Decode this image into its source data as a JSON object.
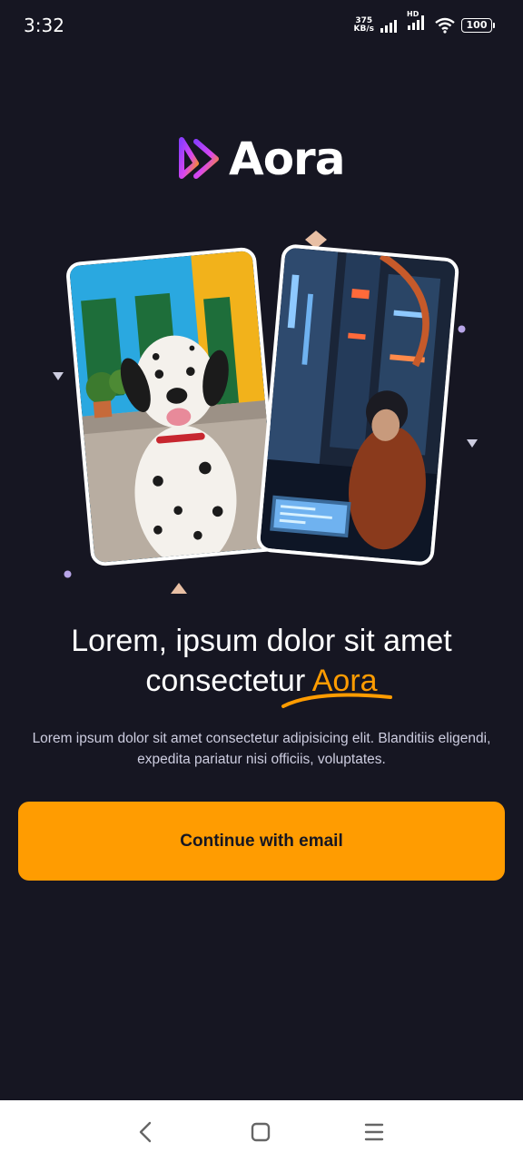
{
  "status_bar": {
    "time": "3:32",
    "net_speed_value": "375",
    "net_speed_unit": "KB/s",
    "network_badge": "HD",
    "battery": "100"
  },
  "brand": {
    "name": "Aora",
    "accent_color": "#FF9C01",
    "background_color": "#161622"
  },
  "hero": {
    "left_card_icon": "dalmatian-dog-photo",
    "right_card_icon": "cyberpunk-hacker-photo"
  },
  "headline": {
    "line1": "Lorem, ipsum dolor sit amet",
    "line2_prefix": "consectetur ",
    "accent_word": "Aora"
  },
  "subtext": "Lorem ipsum dolor sit amet consectetur adipisicing elit. Blanditiis eligendi, expedita pariatur nisi officiis, voluptates.",
  "cta": {
    "label": "Continue with email"
  },
  "nav": {
    "back_icon": "chevron-left-icon",
    "home_icon": "square-home-icon",
    "menu_icon": "hamburger-menu-icon"
  }
}
